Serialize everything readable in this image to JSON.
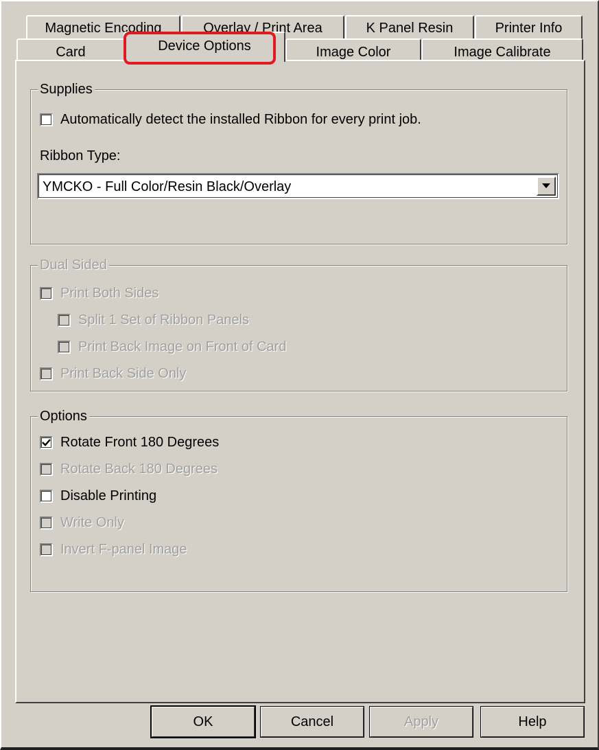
{
  "tabs": {
    "back_row": [
      {
        "label": "Magnetic Encoding"
      },
      {
        "label": "Overlay / Print Area"
      },
      {
        "label": "K Panel Resin"
      },
      {
        "label": "Printer Info"
      }
    ],
    "front_row": [
      {
        "label": "Card"
      },
      {
        "label": "Device Options"
      },
      {
        "label": "Image Color"
      },
      {
        "label": "Image Calibrate"
      }
    ],
    "active": "Device Options"
  },
  "supplies": {
    "title": "Supplies",
    "auto_detect": {
      "label": "Automatically detect the installed Ribbon for every print job.",
      "checked": false
    },
    "ribbon_type_label": "Ribbon Type:",
    "ribbon_type_value": "YMCKO - Full Color/Resin Black/Overlay"
  },
  "dual_sided": {
    "title": "Dual Sided",
    "print_both_sides": {
      "label": "Print Both Sides",
      "checked": false
    },
    "split_ribbon": {
      "label": "Split 1 Set of Ribbon Panels",
      "checked": false
    },
    "print_back_on_front": {
      "label": "Print Back Image on Front of Card",
      "checked": false
    },
    "print_back_only": {
      "label": "Print Back Side Only",
      "checked": false
    }
  },
  "options": {
    "title": "Options",
    "rotate_front": {
      "label": "Rotate Front 180 Degrees",
      "checked": true
    },
    "rotate_back": {
      "label": "Rotate Back 180 Degrees",
      "checked": false
    },
    "disable_printing": {
      "label": "Disable Printing",
      "checked": false
    },
    "write_only": {
      "label": "Write Only",
      "checked": false
    },
    "invert_fpanel": {
      "label": "Invert F-panel Image",
      "checked": false
    }
  },
  "buttons": {
    "ok": "OK",
    "cancel": "Cancel",
    "apply": "Apply",
    "help": "Help"
  },
  "colors": {
    "face": "#d4d0c8",
    "highlight_box": "#e01a22",
    "disabled_text": "#a0a0a0"
  }
}
